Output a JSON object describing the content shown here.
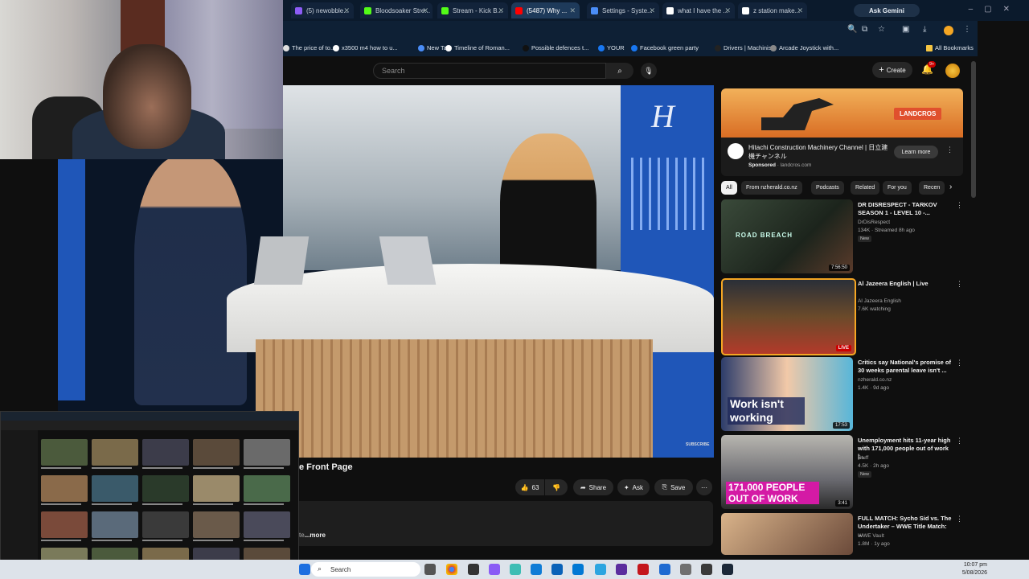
{
  "browser": {
    "tabs": [
      {
        "label": "(5) newobble...",
        "color": "#8d5cf6"
      },
      {
        "label": "Bloodsoaker Stre...",
        "color": "#53fc18"
      },
      {
        "label": "Stream - Kick B...",
        "color": "#53fc18"
      },
      {
        "label": "(5487) Why ...",
        "color": "#ff0000",
        "active": true
      },
      {
        "label": "Settings - Syste...",
        "color": "#4a8df8"
      },
      {
        "label": "what I have the ...",
        "color": "#ffffff"
      },
      {
        "label": "z station make...",
        "color": "#ffffff"
      }
    ],
    "ask_gemini": "Ask Gemini",
    "bookmarks": [
      {
        "label": "The price of to...",
        "color": "#e0e0e0"
      },
      {
        "label": "x3500 m4 how to u...",
        "color": "#ffffff"
      },
      {
        "label": "New Tab",
        "color": "#4a8df8"
      },
      {
        "label": "Timeline of Roman...",
        "color": "#ffffff"
      },
      {
        "label": "Possible defences t...",
        "color": "#111111"
      },
      {
        "label": "YOUR",
        "color": "#1877f2"
      },
      {
        "label": "Facebook green party",
        "color": "#1877f2"
      },
      {
        "label": "Drivers | Machinist",
        "color": "#222222"
      },
      {
        "label": "Arcade Joystick with...",
        "color": "#888888"
      }
    ],
    "all_bookmarks": "All Bookmarks"
  },
  "youtube": {
    "search_placeholder": "Search",
    "create_label": "Create",
    "notif_count": "9+",
    "video_title_fragment": "e Front Page",
    "likes": "63",
    "share": "Share",
    "ask": "Ask",
    "save": "Save",
    "more": "...more",
    "more_prefix": "te"
  },
  "ad": {
    "brand": "LANDCROS",
    "title": "Hitachi Construction Machinery Channel | 日立建機チャンネル",
    "sponsored": "Sponsored",
    "domain": "landcros.com",
    "cta": "Learn more"
  },
  "chips": [
    "All",
    "From nzherald.co.nz",
    "Podcasts",
    "Related",
    "For you",
    "Recen"
  ],
  "videos": [
    {
      "title": "DR DISRESPECT - TARKOV SEASON 1 - LEVEL 10 -...",
      "channel": "DrDisRespect",
      "meta": "134K · Streamed 8h ago",
      "tag": "New",
      "duration": "7:56:50",
      "thumb_caption": "ROAD BREACH"
    },
    {
      "title": "Al Jazeera English | Live",
      "channel": "Al Jazeera English",
      "meta": "7.6K watching",
      "tag": "",
      "duration": "LIVE",
      "thumb_caption": "LIVE"
    },
    {
      "title": "Critics say National's promise of 30 weeks parental leave isn't ...",
      "channel": "nzherald.co.nz",
      "meta": "1.4K · 9d ago",
      "tag": "",
      "duration": "17:53",
      "thumb_caption": "Work isn't working"
    },
    {
      "title": "Unemployment hits 11-year high with 171,000 people out of work |...",
      "channel": "Stuff",
      "meta": "4.5K · 2h ago",
      "tag": "New",
      "duration": "3:41",
      "thumb_caption": "171,000 PEOPLE OUT OF WORK"
    },
    {
      "title": "FULL MATCH: Sycho Sid vs. The Undertaker – WWE Title Match: ...",
      "channel": "WWE Vault",
      "meta": "1.8M · 1y ago",
      "tag": "",
      "duration": "",
      "thumb_caption": ""
    }
  ],
  "player": {
    "logo": "H",
    "watermark": "SUBSCRIBE"
  },
  "taskbar": {
    "search": "Search",
    "time": "10:07 pm",
    "date": "5/08/2026"
  }
}
